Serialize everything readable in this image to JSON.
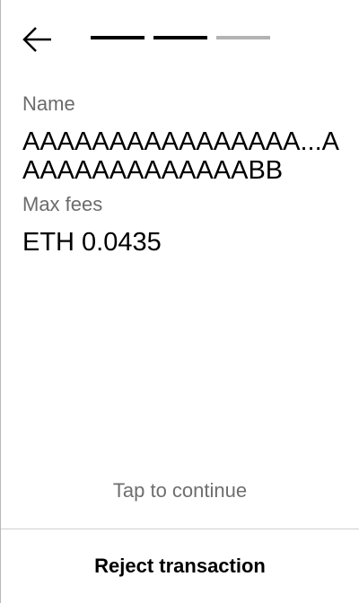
{
  "header": {
    "back_icon": "arrow-left-icon",
    "steps": [
      {
        "state": "complete",
        "color": "#000000"
      },
      {
        "state": "complete",
        "color": "#000000"
      },
      {
        "state": "pending",
        "color": "#b3b3b3"
      }
    ]
  },
  "details": {
    "name_label": "Name",
    "name_value": "AAAAAAAAAAAAAAAA...AAAAAAAAAAAAAABB",
    "fees_label": "Max fees",
    "fees_value": "ETH 0.0435"
  },
  "footer": {
    "tap_hint": "Tap to continue",
    "reject_label": "Reject transaction"
  },
  "colors": {
    "text_primary": "#000000",
    "text_secondary": "#6b6b6b",
    "divider": "#cfcfcf"
  }
}
